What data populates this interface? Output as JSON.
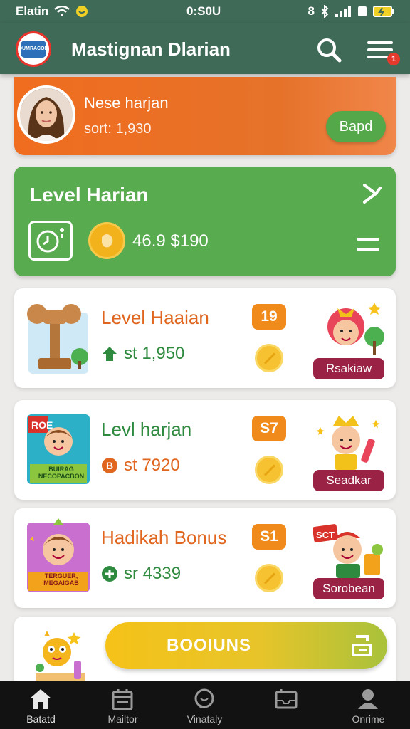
{
  "status_bar": {
    "carrier": "Elatin",
    "time": "0:S0U",
    "right_glyphs": "8"
  },
  "header": {
    "title": "Mastignan Dlarian",
    "logo_text": "OUMRACOM",
    "notification_count": "1"
  },
  "profile": {
    "name": "Nese harjan",
    "subtitle": "sort: 1,930",
    "button_label": "Bapd"
  },
  "level_card": {
    "title": "Level Harian",
    "amount": "46.9 $190"
  },
  "tasks": [
    {
      "title": "Level Haaian",
      "title_color": "#e0651e",
      "amount": "st 1,950",
      "amount_color": "#2e8a3e",
      "badge": "19",
      "tag": "Rsakiaw",
      "poster_text": ""
    },
    {
      "title": "Levl harjan",
      "title_color": "#2e8a3e",
      "amount": "st 7920",
      "amount_color": "#e0651e",
      "badge": "S7",
      "tag": "Seadkar",
      "poster_text": "BUIRAG\nNECOPACBON"
    },
    {
      "title": "Hadikah Bonus",
      "title_color": "#e0651e",
      "amount": "sr 4339",
      "amount_color": "#2e8a3e",
      "badge": "S1",
      "tag": "Sorobean",
      "poster_text": "TERGUER,\nMEGAIGAB"
    }
  ],
  "bonus": {
    "label": "BOOIUNS"
  },
  "nav": {
    "items": [
      "Batatd",
      "Mailtor",
      "Vinataly",
      "",
      "Onrime"
    ]
  }
}
